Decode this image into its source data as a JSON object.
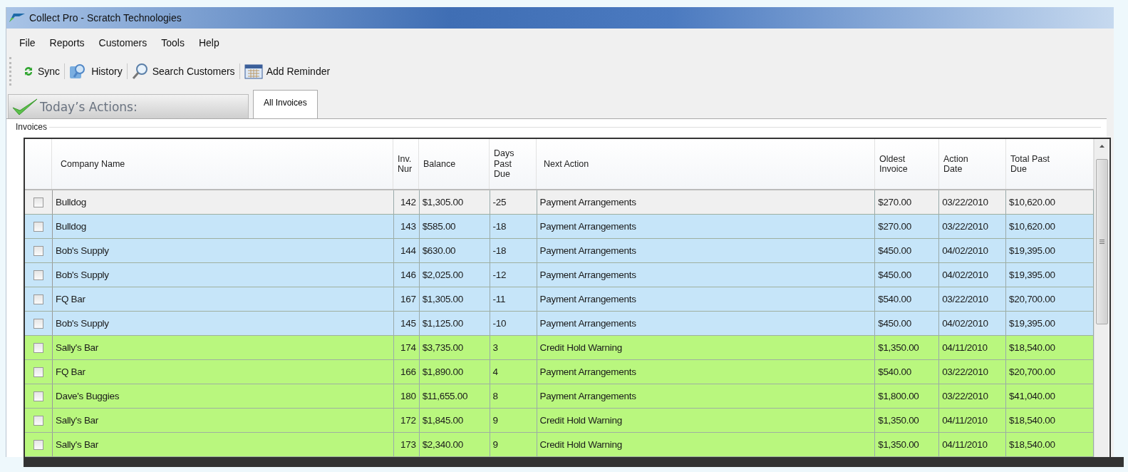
{
  "window": {
    "title": "Collect Pro - Scratch Technologies"
  },
  "menu": [
    "File",
    "Reports",
    "Customers",
    "Tools",
    "Help"
  ],
  "toolbar": [
    {
      "label": "Sync",
      "kind": "sync"
    },
    {
      "label": "History",
      "kind": "history"
    },
    {
      "label": "Search Customers",
      "kind": "search"
    },
    {
      "label": "Add Reminder",
      "kind": "calendar"
    }
  ],
  "tabs": [
    {
      "label": "Today’s Actions:",
      "kind": "banner",
      "selected": false
    },
    {
      "label": "All Invoices",
      "kind": "tab",
      "selected": true
    }
  ],
  "group": {
    "title": "Invoices"
  },
  "table": {
    "columns": [
      "Company Name",
      "Inv. Nur",
      "Balance",
      "Days Past Due",
      "Next Action",
      "Oldest Invoice",
      "Action Date",
      "Total Past Due"
    ],
    "rows": [
      {
        "checked": false,
        "color": "#f0f0f0",
        "cells": [
          "Bulldog",
          "142",
          "$1,305.00",
          "-25",
          "Payment Arrangements",
          "$270.00",
          "03/22/2010",
          "$10,620.00"
        ]
      },
      {
        "checked": false,
        "color": "#c6e5f9",
        "cells": [
          "Bulldog",
          "143",
          "$585.00",
          "-18",
          "Payment Arrangements",
          "$270.00",
          "03/22/2010",
          "$10,620.00"
        ]
      },
      {
        "checked": false,
        "color": "#c6e5f9",
        "cells": [
          "Bob's Supply",
          "144",
          "$630.00",
          "-18",
          "Payment Arrangements",
          "$450.00",
          "04/02/2010",
          "$19,395.00"
        ]
      },
      {
        "checked": false,
        "color": "#c6e5f9",
        "cells": [
          "Bob's Supply",
          "146",
          "$2,025.00",
          "-12",
          "Payment Arrangements",
          "$450.00",
          "04/02/2010",
          "$19,395.00"
        ]
      },
      {
        "checked": false,
        "color": "#c6e5f9",
        "cells": [
          "FQ Bar",
          "167",
          "$1,305.00",
          "-11",
          "Payment Arrangements",
          "$540.00",
          "03/22/2010",
          "$20,700.00"
        ]
      },
      {
        "checked": false,
        "color": "#c6e5f9",
        "cells": [
          "Bob's Supply",
          "145",
          "$1,125.00",
          "-10",
          "Payment Arrangements",
          "$450.00",
          "04/02/2010",
          "$19,395.00"
        ]
      },
      {
        "checked": false,
        "color": "#b9f77e",
        "cells": [
          "Sally's Bar",
          "174",
          "$3,735.00",
          "3",
          "Credit Hold Warning",
          "$1,350.00",
          "04/11/2010",
          "$18,540.00"
        ]
      },
      {
        "checked": false,
        "color": "#b9f77e",
        "cells": [
          "FQ Bar",
          "166",
          "$1,890.00",
          "4",
          "Payment Arrangements",
          "$540.00",
          "03/22/2010",
          "$20,700.00"
        ]
      },
      {
        "checked": false,
        "color": "#b9f77e",
        "cells": [
          "Dave's Buggies",
          "180",
          "$11,655.00",
          "8",
          "Payment Arrangements",
          "$1,800.00",
          "03/22/2010",
          "$41,040.00"
        ]
      },
      {
        "checked": false,
        "color": "#b9f77e",
        "cells": [
          "Sally's Bar",
          "172",
          "$1,845.00",
          "9",
          "Credit Hold Warning",
          "$1,350.00",
          "04/11/2010",
          "$18,540.00"
        ]
      },
      {
        "checked": false,
        "color": "#b9f77e",
        "cells": [
          "Sally's Bar",
          "173",
          "$2,340.00",
          "9",
          "Credit Hold Warning",
          "$1,350.00",
          "04/11/2010",
          "$18,540.00"
        ]
      }
    ]
  }
}
